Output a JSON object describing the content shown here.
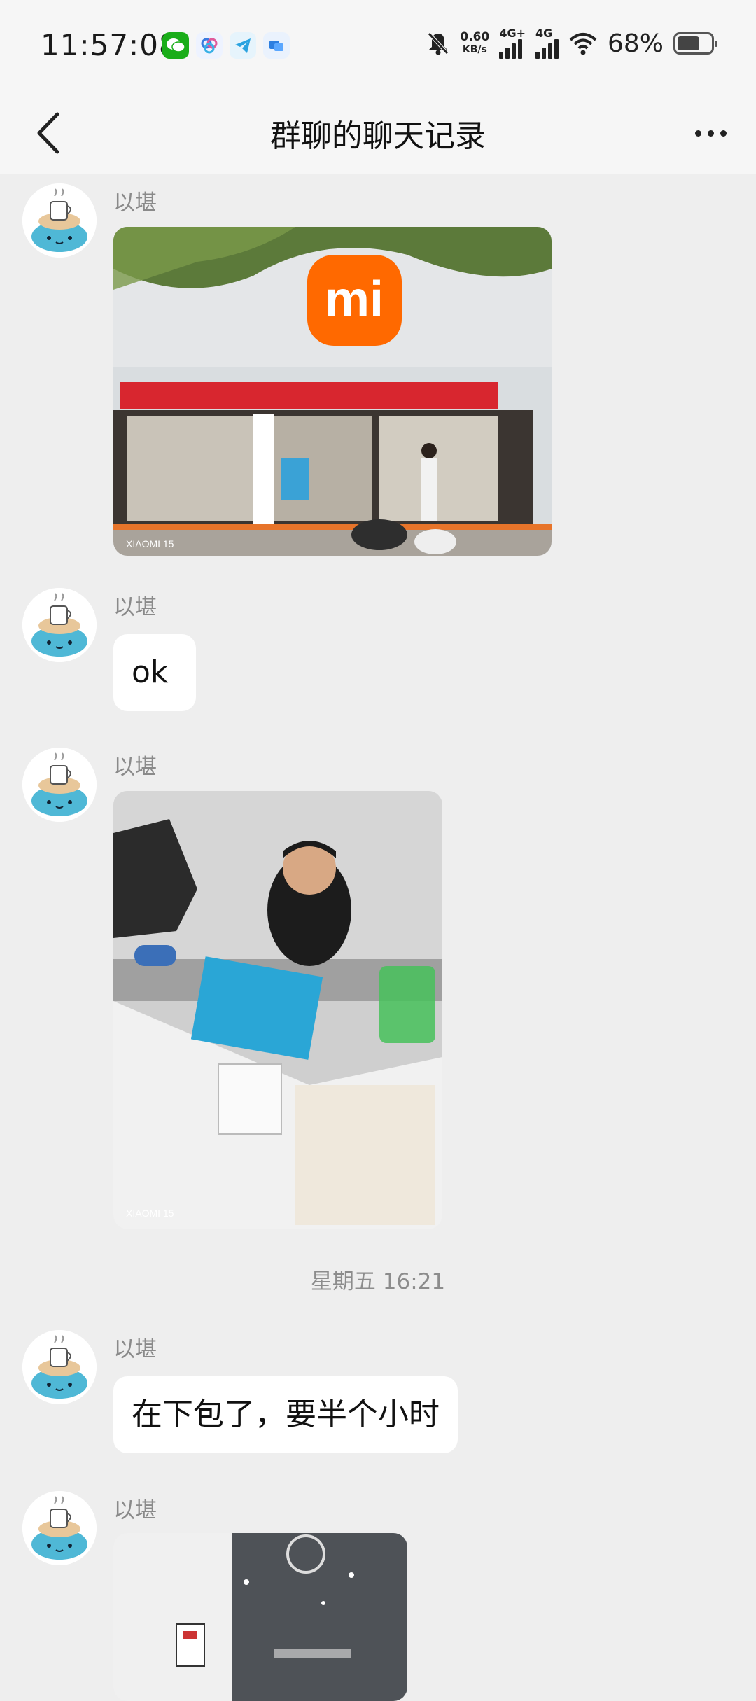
{
  "status_bar": {
    "time": "11:57:08",
    "net_speed_value": "0.60",
    "net_speed_unit": "KB/s",
    "sim1": "4G+",
    "sim2": "4G",
    "battery_percent": "68%",
    "battery_level": 0.68,
    "app_icons": [
      "wechat-icon",
      "app-icon-blue",
      "telegram-icon",
      "app-icon-square"
    ]
  },
  "header": {
    "title": "群聊的聊天记录",
    "back_icon": "chevron-left-icon",
    "more_icon": "more-horizontal-icon"
  },
  "messages": [
    {
      "sender": "以堪",
      "type": "image",
      "image_desc": "storefront-photo",
      "logo_text": "mi",
      "watermark": "XIAOMI 15"
    },
    {
      "sender": "以堪",
      "type": "text",
      "text": "ok"
    },
    {
      "sender": "以堪",
      "type": "image",
      "image_desc": "repair-desk-photo",
      "watermark": "XIAOMI 15"
    },
    {
      "sender": "以堪",
      "type": "text",
      "text": "在下包了，要半个小时"
    },
    {
      "sender": "以堪",
      "type": "image",
      "image_desc": "service-center-photo"
    }
  ],
  "timestamp": "星期五 16:21",
  "colors": {
    "background": "#eeeeee",
    "bubble": "#ffffff",
    "xiaomi_orange": "#ff6900",
    "avatar_blue": "#4fb8d6"
  }
}
